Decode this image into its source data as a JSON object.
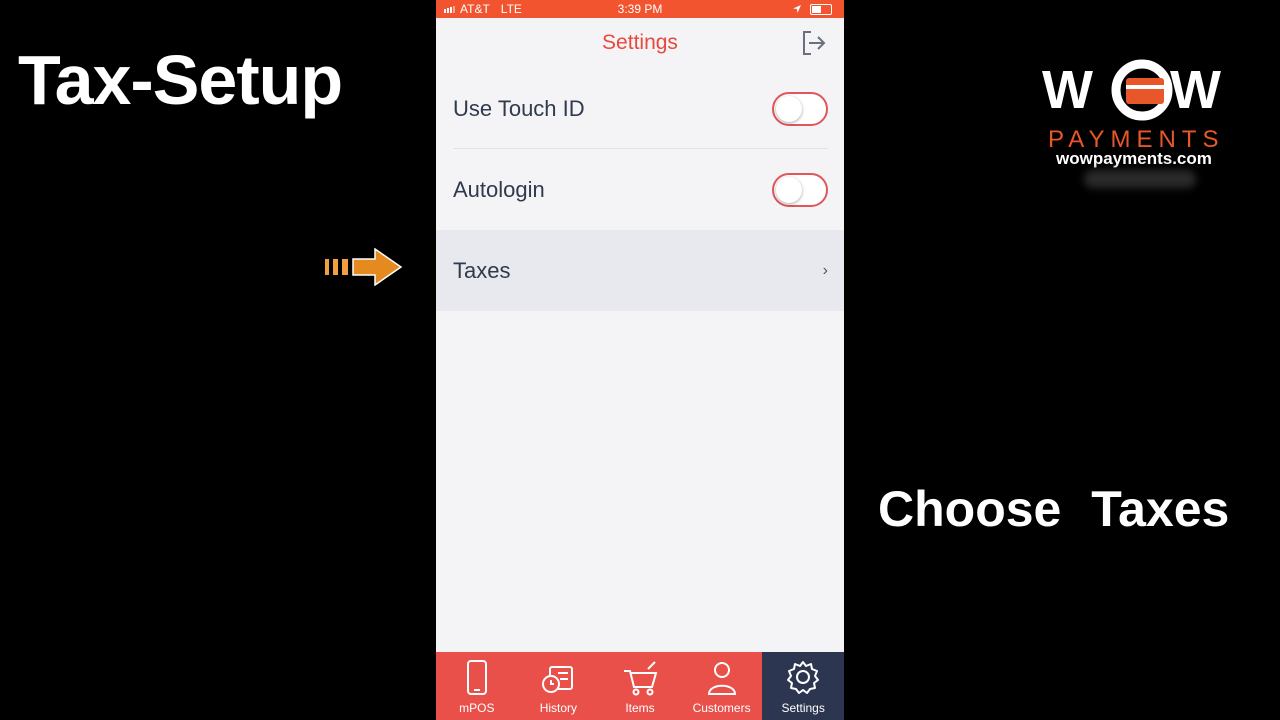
{
  "overlay": {
    "title": "Tax-Setup",
    "hint": "Choose Taxes"
  },
  "logo": {
    "word": "WOW",
    "sub": "PAYMENTS",
    "url": "wowpayments.com",
    "accent": "#e8572a"
  },
  "status_bar": {
    "carrier": "AT&T",
    "network": "LTE",
    "time": "3:39 PM"
  },
  "navbar": {
    "title": "Settings"
  },
  "settings": {
    "rows": [
      {
        "label": "Use Touch ID",
        "control": "toggle",
        "on": false
      },
      {
        "label": "Autologin",
        "control": "toggle",
        "on": false
      },
      {
        "label": "Taxes",
        "control": "chevron",
        "chevron": "›"
      }
    ]
  },
  "tabbar": {
    "tabs": [
      {
        "label": "mPOS",
        "icon": "phone-icon"
      },
      {
        "label": "History",
        "icon": "history-icon"
      },
      {
        "label": "Items",
        "icon": "cart-icon"
      },
      {
        "label": "Customers",
        "icon": "person-icon"
      },
      {
        "label": "Settings",
        "icon": "gear-icon",
        "active": true
      }
    ]
  },
  "colors": {
    "brand": "#e9504a",
    "status": "#f1542f",
    "active_tab": "#2d3650",
    "title": "#e8493a"
  }
}
